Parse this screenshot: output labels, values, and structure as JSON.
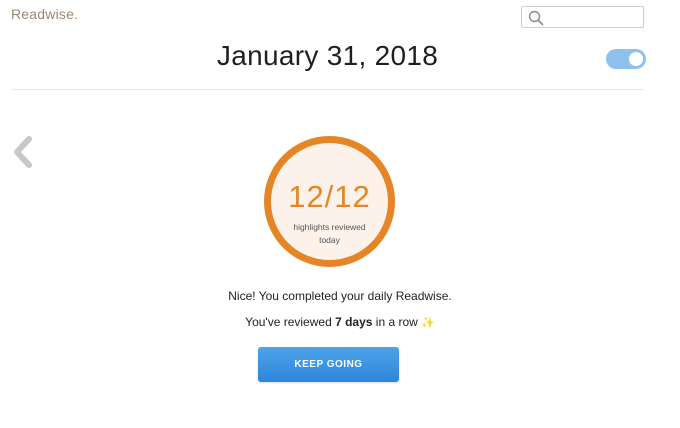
{
  "header": {
    "logo": "Readwise.",
    "search_placeholder": ""
  },
  "date_title": "January 31, 2018",
  "toggle": {
    "on": true
  },
  "progress": {
    "count_text": "12/12",
    "reviewed": 12,
    "total": 12,
    "label": "highlights reviewed today"
  },
  "message": "Nice! You completed your daily Readwise.",
  "streak": {
    "prefix": "You've reviewed ",
    "days": "7 days",
    "suffix": " in a row ",
    "emoji": "✨"
  },
  "button_label": "KEEP GOING",
  "colors": {
    "accent_orange": "#e68526",
    "ring_fill": "#fdf2ea",
    "button_blue": "#3a92e0",
    "toggle_blue": "#8ec1ee",
    "logo": "#9a8873"
  },
  "icons": [
    "search-icon",
    "chevron-left-icon"
  ]
}
